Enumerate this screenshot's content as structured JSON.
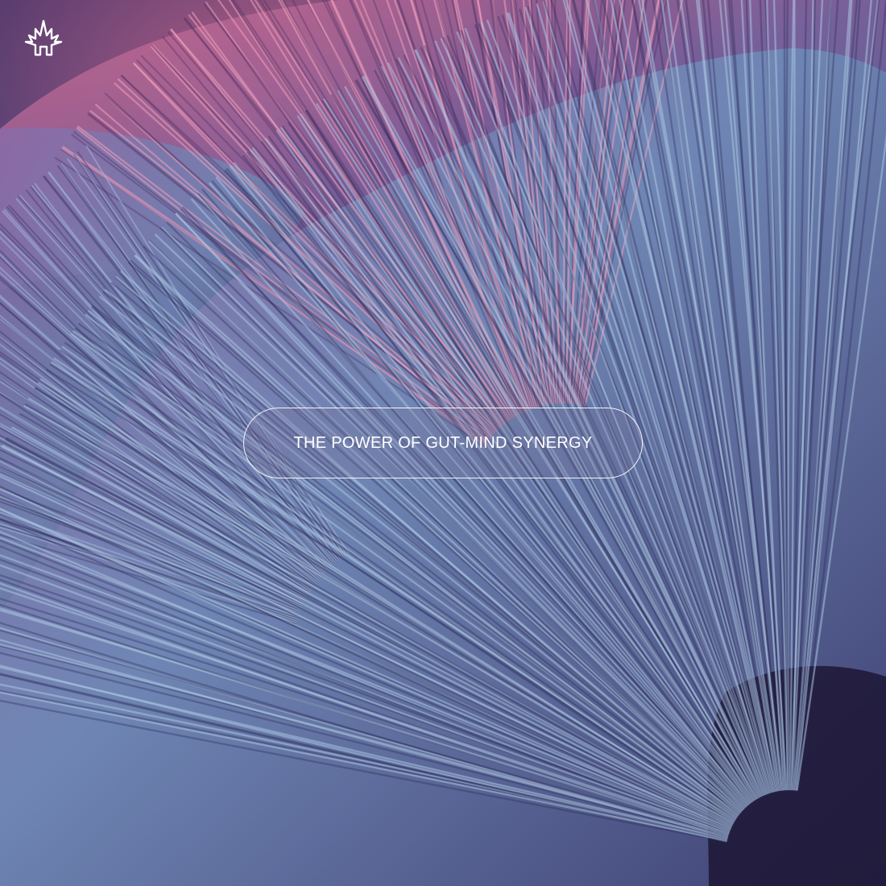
{
  "hero": {
    "headline": "THE POWER OF GUT-MIND SYNERGY"
  },
  "brand": {
    "logo_icon": "mushroom-logo-icon"
  },
  "colors": {
    "text": "#ffffff",
    "pill_border": "#ffffff",
    "gill_pink": "#d6688c",
    "gill_blue": "#5c8cb2",
    "shadow": "#140e28"
  }
}
